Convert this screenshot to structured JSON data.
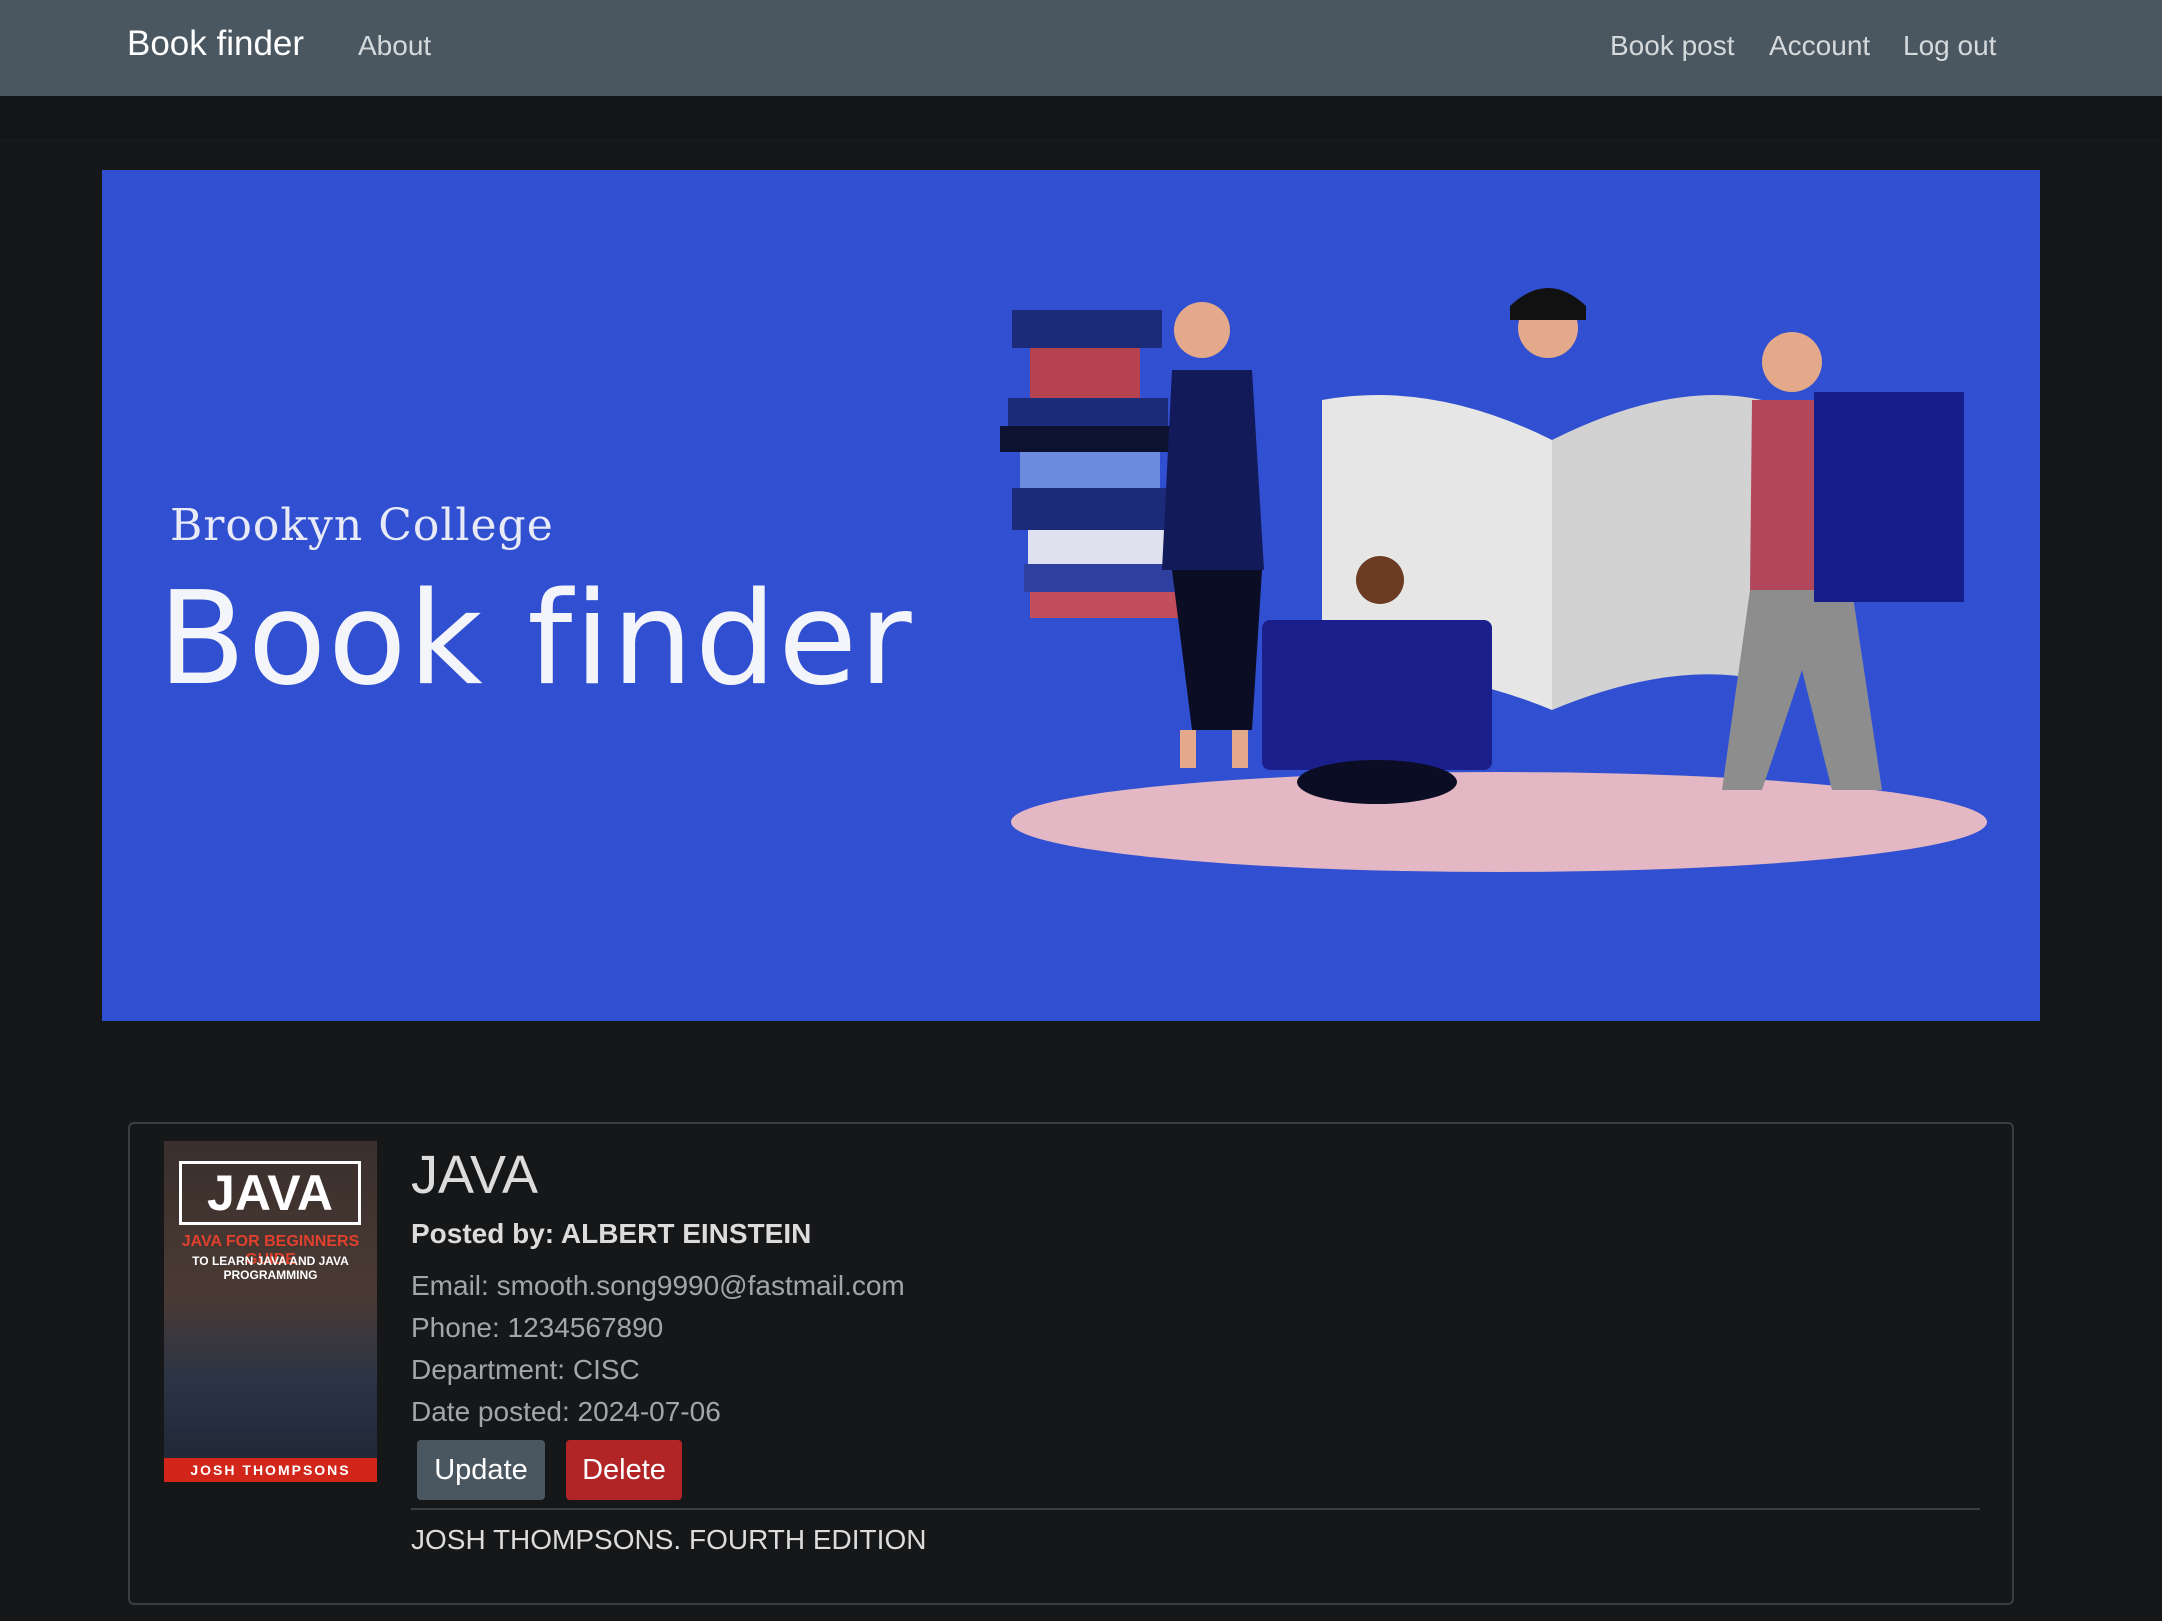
{
  "navbar": {
    "brand": "Book finder",
    "links": [
      "About"
    ],
    "right_links": [
      "Book post",
      "Account",
      "Log out"
    ]
  },
  "banner": {
    "college": "Brookyn College",
    "title": "Book finder"
  },
  "post": {
    "title": "JAVA",
    "posted_by": "Posted by: ALBERT EINSTEIN",
    "email": "Email: smooth.song9990@fastmail.com",
    "phone": "Phone: 1234567890",
    "department": "Department: CISC",
    "date_posted": "Date posted: 2024-07-06",
    "update_label": "Update",
    "delete_label": "Delete",
    "description": "JOSH THOMPSONS. FOURTH EDITION",
    "cover": {
      "title": "JAVA",
      "subtitle1": "JAVA FOR BEGINNERS GUIDE",
      "subtitle2": "TO LEARN JAVA AND JAVA PROGRAMMING",
      "author": "JOSH THOMPSONS"
    }
  },
  "colors": {
    "navbar_bg": "#4a5761",
    "page_bg": "#151719",
    "banner_bg": "#3150d1",
    "update_btn": "#4a5761",
    "delete_btn": "#b12527"
  }
}
